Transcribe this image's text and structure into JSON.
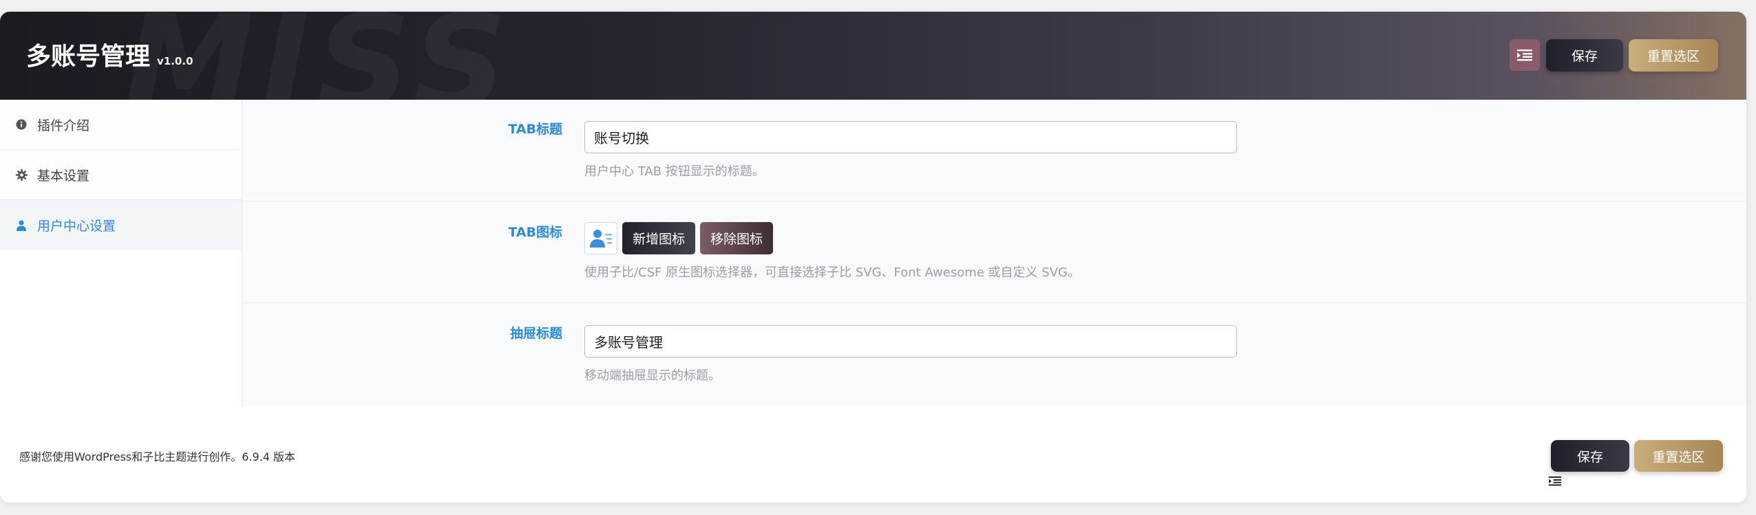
{
  "header": {
    "watermark": "MISS",
    "title": "多账号管理",
    "version": "v1.0.0",
    "save_label": "保存",
    "reset_label": "重置选区"
  },
  "sidebar": {
    "items": [
      {
        "label": "插件介绍",
        "icon": "info-circle-icon"
      },
      {
        "label": "基本设置",
        "icon": "gear-icon"
      },
      {
        "label": "用户中心设置",
        "icon": "user-icon",
        "active": true
      }
    ]
  },
  "fields": {
    "tab_title": {
      "label": "TAB标题",
      "value": "账号切换",
      "desc": "用户中心 TAB 按钮显示的标题。"
    },
    "tab_icon": {
      "label": "TAB图标",
      "add_label": "新增图标",
      "remove_label": "移除图标",
      "desc": "使用子比/CSF 原生图标选择器，可直接选择子比 SVG、Font Awesome 或自定义 SVG。"
    },
    "drawer_title": {
      "label": "抽屉标题",
      "value": "多账号管理",
      "desc": "移动端抽屉显示的标题。"
    }
  },
  "footer": {
    "credit": "感谢您使用WordPress和子比主题进行创作。6.9.4 版本",
    "save_label": "保存",
    "reset_label": "重置选区"
  },
  "colors": {
    "accent": "#2a8bd6",
    "gold": "#b89866",
    "dark": "#22232c"
  }
}
